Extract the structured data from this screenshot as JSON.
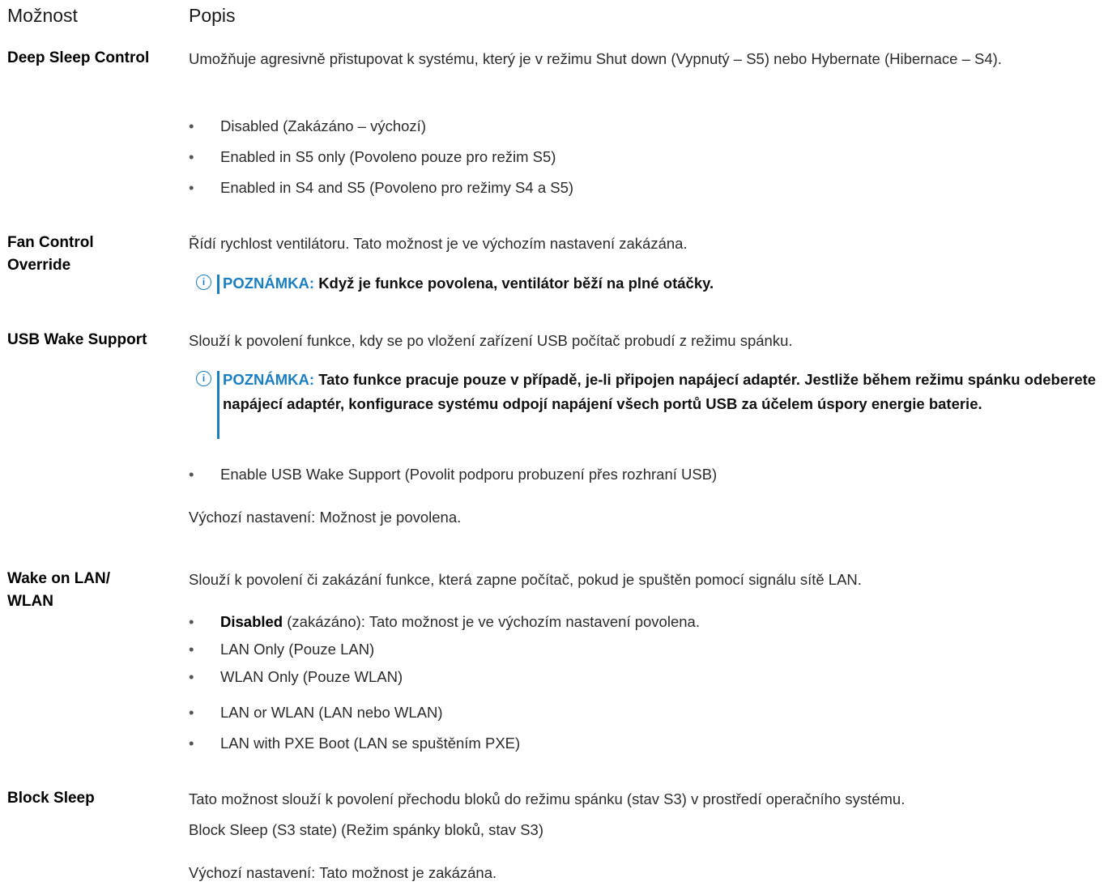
{
  "header": {
    "option": "Možnost",
    "description": "Popis"
  },
  "rows": [
    {
      "option": "Deep Sleep Control",
      "desc": "Umožňuje agresivně přistupovat k systému, který je v režimu Shut down (Vypnutý – S5) nebo Hybernate (Hibernace – S4).",
      "bullets": [
        "Disabled (Zakázáno – výchozí)",
        "Enabled in S5 only (Povoleno pouze pro režim S5)",
        "Enabled in S4 and S5 (Povoleno pro režimy S4 a S5)"
      ]
    },
    {
      "option_line1": "Fan Control",
      "option_line2": "Override",
      "desc": "Řídí rychlost ventilátoru. Tato možnost je ve výchozím nastavení zakázána.",
      "note_label": "POZNÁMKA:",
      "note_text": "Když je funkce povolena, ventilátor běží na plné otáčky."
    },
    {
      "option": "USB Wake Support",
      "desc": "Slouží k povolení funkce, kdy se po vložení zařízení USB počítač probudí z režimu spánku.",
      "note_label": "POZNÁMKA:",
      "note_text": "Tato funkce pracuje pouze v případě, je-li připojen napájecí adaptér. Jestliže během režimu spánku odeberete napájecí adaptér, konfigurace systému odpojí napájení všech portů USB za účelem úspory energie baterie.",
      "bullet": "Enable USB Wake Support (Povolit podporu probuzení přes rozhraní USB)",
      "default": "Výchozí nastavení: Možnost je povolena."
    },
    {
      "option_line1": "Wake on LAN/",
      "option_line2": "WLAN",
      "desc": "Slouží k povolení či zakázání funkce, která zapne počítač, pokud je spuštěn pomocí signálu sítě LAN.",
      "bullet1_bold": "Disabled",
      "bullet1_rest": " (zakázáno): Tato možnost je ve výchozím nastavení povolena.",
      "bullets": [
        "LAN Only (Pouze LAN)",
        "WLAN Only (Pouze WLAN)",
        "LAN or WLAN (LAN nebo WLAN)",
        "LAN with PXE Boot (LAN se spuštěním PXE)"
      ]
    },
    {
      "option": "Block Sleep",
      "desc": "Tato možnost slouží k povolení přechodu bloků do režimu spánku (stav S3) v prostředí operačního systému.",
      "line2": "Block Sleep (S3 state) (Režim spánky bloků, stav S3)",
      "default": "Výchozí nastavení: Tato možnost je zakázána."
    }
  ],
  "bullet_char": "•",
  "note_icon": "i"
}
